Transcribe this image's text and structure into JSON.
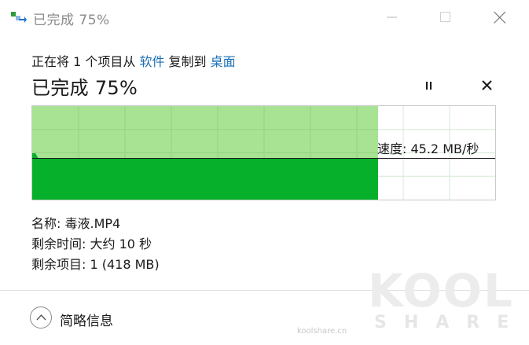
{
  "window": {
    "title": "已完成 75%"
  },
  "copy": {
    "prefix": "正在将 1 个项目从 ",
    "source": "软件",
    "middle": " 复制到 ",
    "destination": "桌面"
  },
  "progress": {
    "headline": "已完成 75%",
    "fraction": 0.75
  },
  "speed": {
    "label": "速度: 45.2 MB/秒"
  },
  "details": {
    "name_row": "名称: 毒液.MP4",
    "time_row": "剩余时间: 大约 10 秒",
    "items_row": "剩余项目: 1 (418 MB)"
  },
  "footer": {
    "less_info_label": "简略信息"
  },
  "watermark": {
    "logo_text": "KOOL",
    "share_text": "SHARE",
    "url": "koolshare.cn"
  },
  "colors": {
    "fill_dark": "#06b02a",
    "fill_light": "#a8e394",
    "grid_light": "#d6e8d6",
    "link": "#1a6fb5"
  },
  "icons": {
    "app": "copy-arrow-icon",
    "minimize": "minimize-icon",
    "maximize": "maximize-icon",
    "close": "close-icon",
    "pause": "pause-icon",
    "cancel": "cancel-x-icon",
    "collapse": "chevron-up-icon"
  }
}
